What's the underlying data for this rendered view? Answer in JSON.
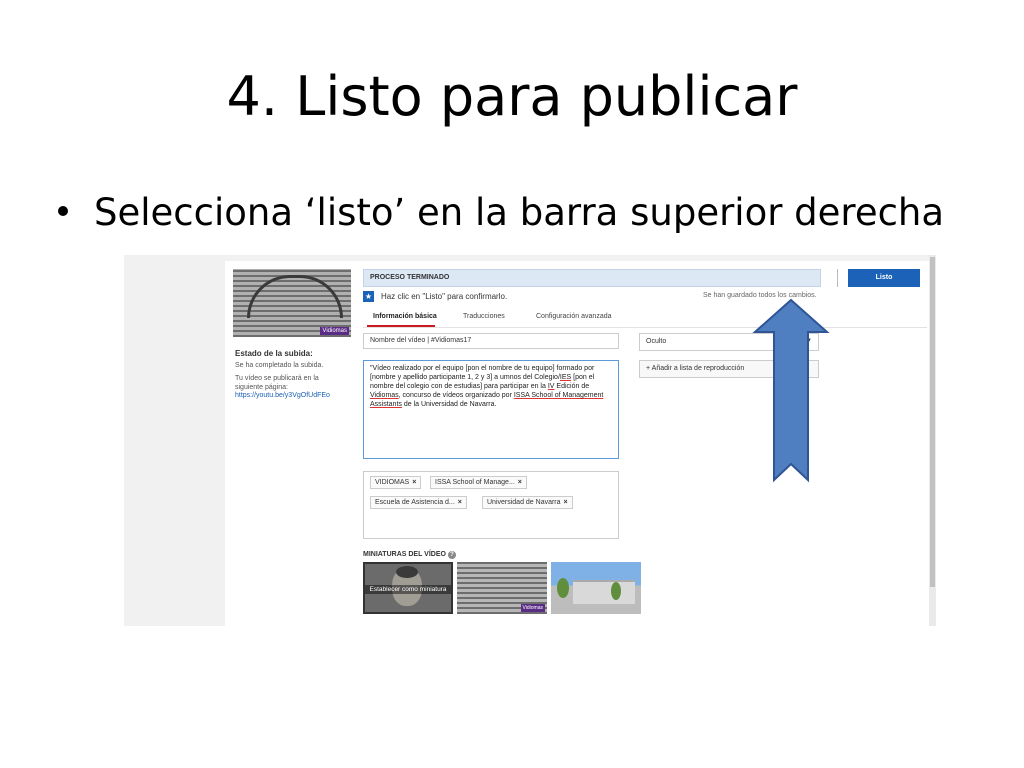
{
  "slide": {
    "title": "4. Listo para publicar",
    "bullet": "Selecciona ‘listo’ en la barra superior derecha"
  },
  "screenshot": {
    "left_panel": {
      "upload_status_title": "Estado de la subida:",
      "upload_done": "Se ha completado la subida.",
      "publish_note": "Tu vídeo se publicará en la siguiente página:",
      "video_url": "https://youtu.be/y3VgOfUdFEo",
      "thumbnail_badge": "Vidiomas"
    },
    "status_bar": {
      "label": "PROCESO TERMINADO",
      "done_button": "Listo",
      "confirm_text": "Haz clic en \"Listo\" para confirmarlo.",
      "saved_text": "Se han guardado todos los cambios."
    },
    "tabs": [
      "Información básica",
      "Traducciones",
      "Configuración avanzada"
    ],
    "title_field": "Nombre del vídeo | #Vidiomas17",
    "description": {
      "part1": "\"Vídeo realizado por el equipo [pon el nombre de tu equipo] formado por [nombre y apellido participante 1, 2 y 3] a umnos del Colegio/",
      "ies": "IES",
      "part2": " [pon el nombre del colegio con de estudias] para participar en la ",
      "iv": "IV",
      "part3": " Edición de ",
      "vidiomas": "Vidiomas",
      "part4": ", concurso de vídeos organizado por ",
      "issa": "ISSA School of Management Assistants",
      "part5": " de la Universidad de Navarra."
    },
    "tags": [
      "VIDIOMAS",
      "ISSA School of Manage...",
      "Escuela de Asistencia d...",
      "Universidad de Navarra"
    ],
    "tag_remove_symbol": "×",
    "privacy_select": "Oculto",
    "privacy_arrow": "▼",
    "playlist_button": "+ Añadir a lista de reproducción",
    "thumbnails_label": "MINIATURAS DEL VÍDEO",
    "help_symbol": "?",
    "set_thumbnail_caption": "Establecer como miniatura",
    "info_symbol": "★"
  },
  "colors": {
    "done_button": "#1c62b9",
    "status_bar": "#dde8f5",
    "arrow_fill": "#4f7fc0",
    "arrow_stroke": "#2f5597"
  }
}
